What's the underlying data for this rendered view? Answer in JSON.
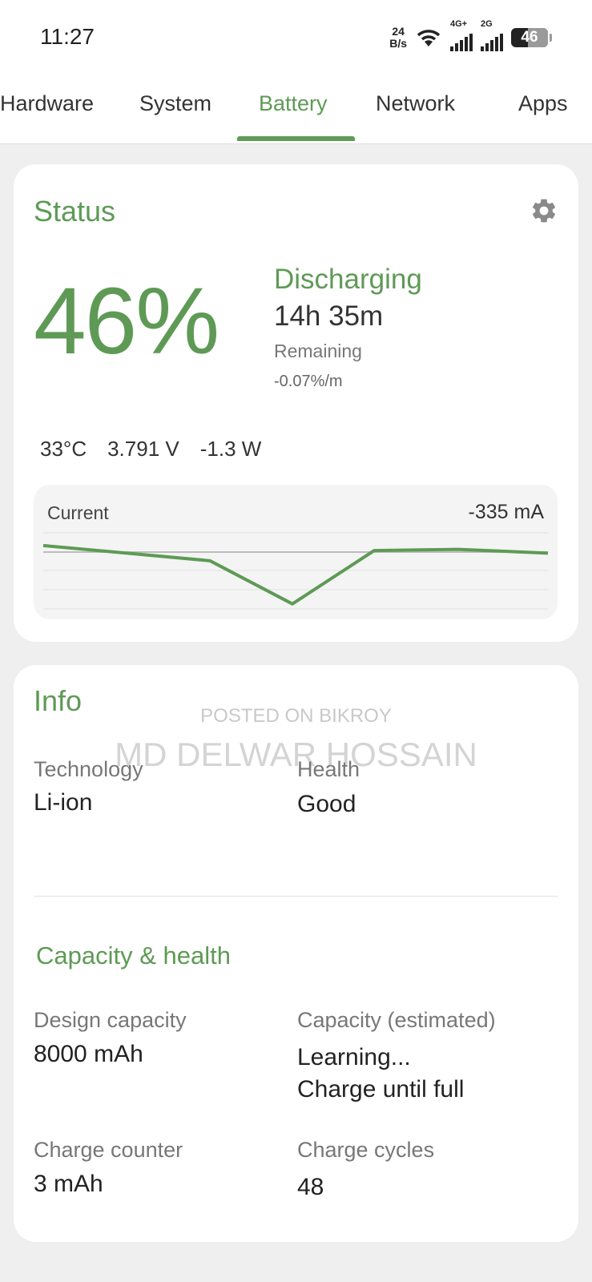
{
  "status_bar": {
    "time": "11:27",
    "net_speed_value": "24",
    "net_speed_unit": "B/s",
    "sim1_label": "4G+",
    "sim2_label": "2G",
    "battery_level": "46",
    "battery_fraction": 0.46
  },
  "tabs": [
    {
      "label": "Hardware"
    },
    {
      "label": "System"
    },
    {
      "label": "Battery"
    },
    {
      "label": "Network"
    },
    {
      "label": "Apps"
    }
  ],
  "active_tab": "Battery",
  "status": {
    "title": "Status",
    "percent": "46%",
    "state": "Discharging",
    "time_remaining": "14h 35m",
    "remaining_label": "Remaining",
    "rate": "-0.07%/m",
    "temperature": "33°C",
    "voltage": "3.791 V",
    "power": "-1.3 W",
    "chart": {
      "label": "Current",
      "value": "-335 mA",
      "samples": [
        -290,
        -302,
        -336,
        -294,
        -293,
        -296
      ]
    }
  },
  "watermark": {
    "line1": "POSTED ON BIKROY",
    "line2": "MD DELWAR HOSSAIN"
  },
  "info": {
    "title": "Info",
    "technology_label": "Technology",
    "technology_value": "Li-ion",
    "health_label": "Health",
    "health_value": "Good"
  },
  "capacity": {
    "title": "Capacity & health",
    "design_label": "Design capacity",
    "design_value": "8000 mAh",
    "estimated_label": "Capacity (estimated)",
    "estimated_value_line1": "Learning...",
    "estimated_value_line2": "Charge until full",
    "counter_label": "Charge counter",
    "counter_value": "3 mAh",
    "cycles_label": "Charge cycles",
    "cycles_value": "48"
  },
  "colors": {
    "accent": "#5e9a55",
    "background": "#efefef",
    "card": "#ffffff"
  }
}
